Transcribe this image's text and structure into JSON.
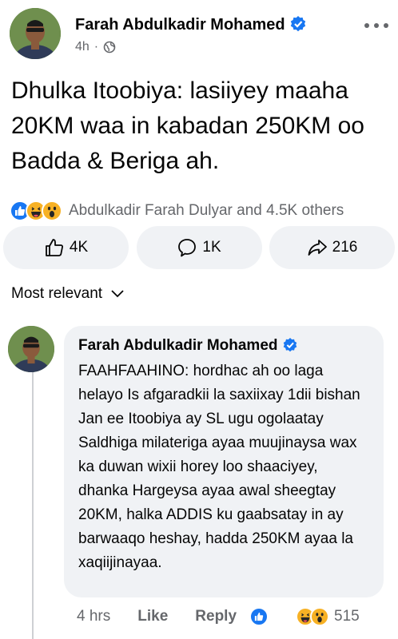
{
  "post": {
    "author": "Farah Abdulkadir Mohamed",
    "time": "4h",
    "separator": "·",
    "text": "Dhulka Itoobiya: lasiiyey maaha 20KM waa in kabadan 250KM oo Badda & Beriga ah.",
    "reactions_summary": "Abdulkadir Farah Dulyar and 4.5K others"
  },
  "actions": {
    "like_count": "4K",
    "comment_count": "1K",
    "share_count": "216"
  },
  "sort": {
    "label": "Most relevant"
  },
  "comment": {
    "author": "Farah Abdulkadir Mohamed",
    "text": "FAAHFAAHINO: hordhac ah oo laga helayo Is afgaradkii la saxiixay 1dii bishan Jan ee Itoobiya ay SL ugu ogolaatay Saldhiga milateriga ayaa muujinaysa wax ka duwan wixii horey loo shaaciyey, dhanka Hargeysa ayaa awal sheegtay 20KM, halka ADDIS ku gaabsatay in ay barwaaqo heshay, hadda 250KM ayaa la xaqiijinayaa.",
    "time": "4 hrs",
    "like_label": "Like",
    "reply_label": "Reply",
    "reaction_count": "515"
  },
  "colors": {
    "facebook_blue": "#1877f2",
    "secondary_text": "#65676b",
    "bubble_bg": "#f0f2f5",
    "emoji_yellow": "#f7b125"
  },
  "icons": [
    "verified-badge-icon",
    "globe-icon",
    "more-options-icon",
    "like-reaction-icon",
    "haha-reaction-icon",
    "wow-reaction-icon",
    "thumbs-up-icon",
    "comment-icon",
    "share-icon",
    "chevron-down-icon"
  ]
}
